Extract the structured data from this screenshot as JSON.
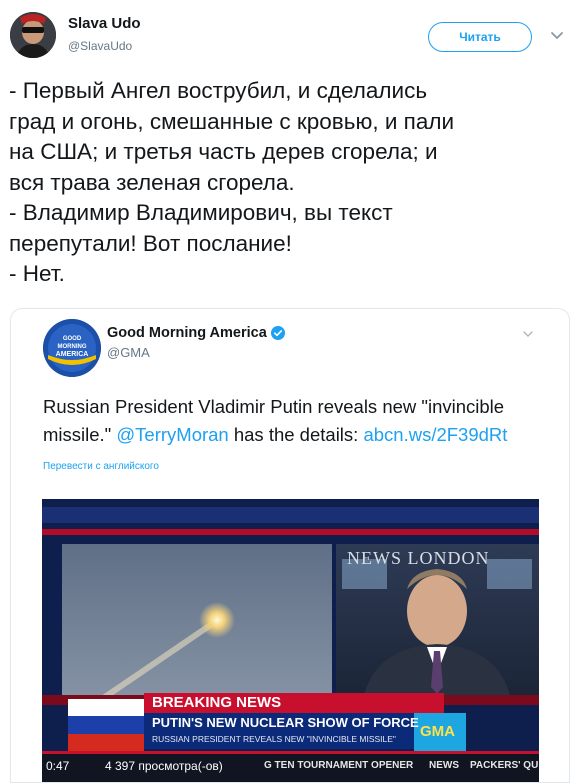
{
  "author": {
    "name": "Slava Udo",
    "handle": "@SlavaUdo",
    "follow_label": "Читать"
  },
  "tweet_lines": [
    "- Первый Ангел вострубил, и сделались",
    "град и огонь, смешанные с кровью, и пали",
    "на США; и третья часть дерев сгорела; и",
    "вся трава зеленая сгорела.",
    "- Владимир Владимирович, вы текст",
    "перепутали! Вот послание!",
    "- Нет."
  ],
  "quoted": {
    "name": "Good Morning America",
    "handle": "@GMA",
    "avatar_text": [
      "GOOD",
      "MORNING",
      "AMERICA"
    ],
    "text_line1": "Russian President Vladimir Putin reveals new \"invincible",
    "text_line2_start": "missile.\" ",
    "mention": "@TerryMoran",
    "text_line2_mid": " has the details: ",
    "url": "abcn.ws/2F39dRt",
    "translate_label": "Перевести с английского"
  },
  "video": {
    "backdrop_text": "NEWS LONDON",
    "banner_top": "BREAKING NEWS",
    "banner_headline": "PUTIN'S NEW NUCLEAR SHOW OF FORCE",
    "banner_sub": "RUSSIAN PRESIDENT REVEALS NEW \"INVINCIBLE MISSILE\"",
    "logo": "GMA",
    "time": "0:47",
    "views": "4 397 просмотра(-ов)",
    "ticker": "G TEN TOURNAMENT OPENER",
    "ticker_news": "NEWS",
    "ticker_right": "PACKERS' QU"
  },
  "colors": {
    "link": "#1da1f2",
    "text": "#14171a",
    "muted": "#657786",
    "banner_red": "#c8102e",
    "banner_blue": "#0b2a7a"
  }
}
